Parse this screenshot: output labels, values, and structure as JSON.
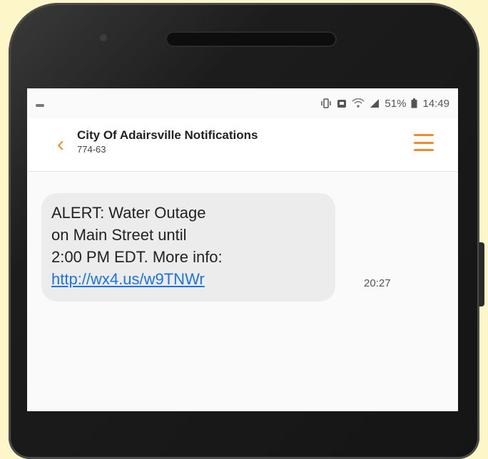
{
  "status_bar": {
    "battery": "51%",
    "time": "14:49"
  },
  "header": {
    "title": "City Of Adairsville Notifications",
    "subtitle": "774-63"
  },
  "message": {
    "line1": "ALERT: Water Outage",
    "line2": "on Main Street until",
    "line3": "2:00 PM EDT. More info:",
    "link": "http://wx4.us/w9TNWr",
    "time": "20:27"
  },
  "colors": {
    "accent": "#f08a2c",
    "link": "#1a73e8",
    "background": "#fdf6c9"
  },
  "icons": {
    "back": "chevron-left-icon",
    "menu": "hamburger-menu-icon",
    "vibrate": "vibrate-icon",
    "alarm": "alarm-icon",
    "wifi": "wifi-icon",
    "signal": "signal-icon",
    "battery": "battery-icon"
  }
}
